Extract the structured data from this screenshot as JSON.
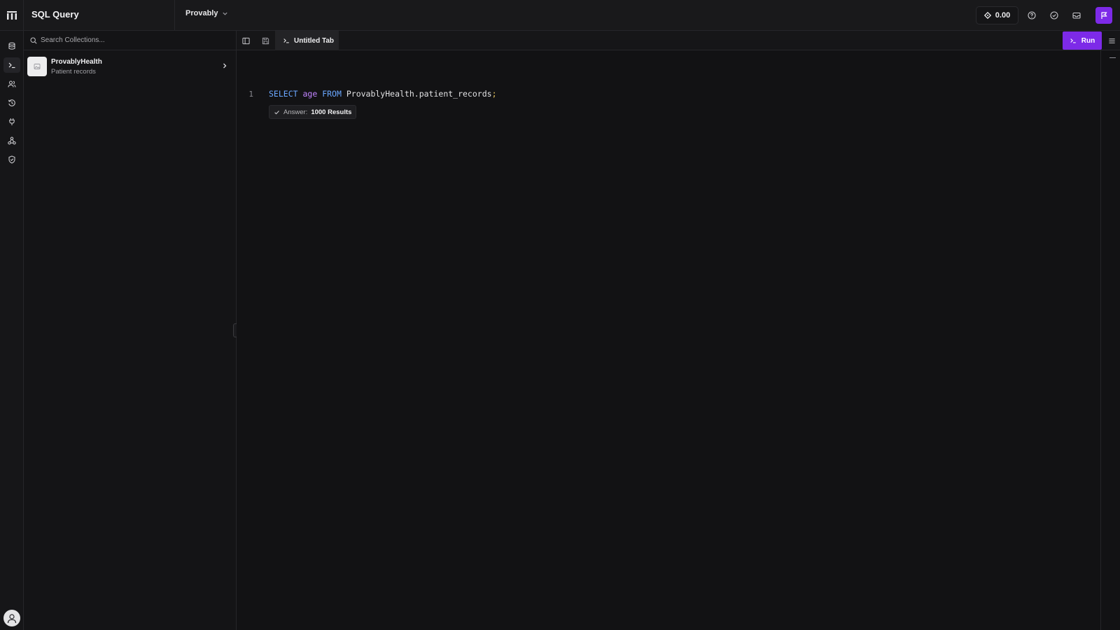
{
  "header": {
    "title": "SQL Query",
    "org": "Provably",
    "balance": "0.00",
    "accent_color": "#7d2ae8",
    "icons": [
      "grid-logo-icon",
      "chevron-down-icon",
      "diamond-icon",
      "help-icon",
      "check-circle-icon",
      "inbox-icon",
      "feedback-flag-icon"
    ]
  },
  "rail": {
    "items": [
      {
        "name": "database-icon"
      },
      {
        "name": "terminal-icon",
        "active": true
      },
      {
        "name": "users-icon"
      },
      {
        "name": "history-icon"
      },
      {
        "name": "plug-icon"
      },
      {
        "name": "network-icon"
      },
      {
        "name": "shield-icon"
      }
    ],
    "avatar_icon": "user-avatar-icon"
  },
  "collections": {
    "search_placeholder": "Search Collections...",
    "items": [
      {
        "name": "ProvablyHealth",
        "description": "Patient records"
      }
    ]
  },
  "editor": {
    "tab_label": "Untitled Tab",
    "run_label": "Run",
    "line_number": "1",
    "code": {
      "select": "SELECT",
      "column": "age",
      "from": "FROM",
      "table": "ProvablyHealth.patient_records",
      "terminator": ";"
    },
    "answer": {
      "label": "Answer:",
      "value": "1000 Results"
    }
  }
}
